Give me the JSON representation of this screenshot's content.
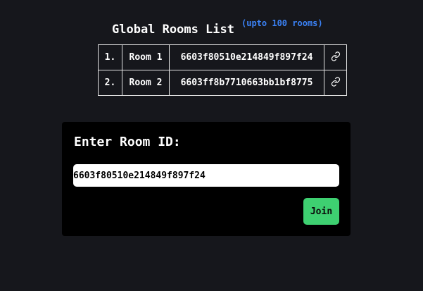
{
  "heading": {
    "title": "Global Rooms List",
    "subtitle": "(upto 100 rooms)"
  },
  "rooms": [
    {
      "index": "1.",
      "name": "Room 1",
      "id": "6603f80510e214849f897f24",
      "icon": "link-icon"
    },
    {
      "index": "2.",
      "name": "Room 2",
      "id": "6603ff8b7710663bb1bf8775",
      "icon": "link-icon"
    }
  ],
  "join_form": {
    "label": "Enter Room ID:",
    "input_value": "6603f80510e214849f897f24",
    "button_label": "Join"
  },
  "colors": {
    "background": "#16171c",
    "card": "#000000",
    "accent_blue": "#3b82f6",
    "button_green": "#3ed071"
  }
}
